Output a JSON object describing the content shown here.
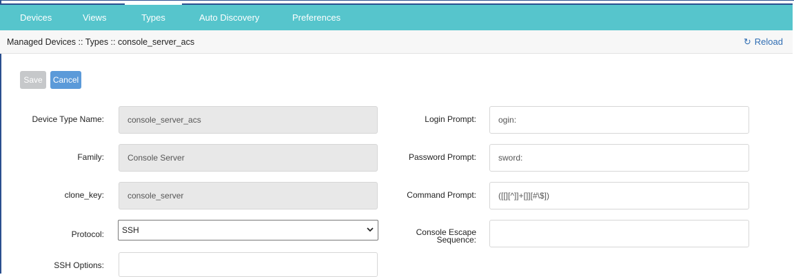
{
  "nav": {
    "tabs": [
      {
        "label": "Devices"
      },
      {
        "label": "Views"
      },
      {
        "label": "Types",
        "active": true
      },
      {
        "label": "Auto Discovery"
      },
      {
        "label": "Preferences"
      }
    ]
  },
  "breadcrumb": "Managed Devices :: Types :: console_server_acs",
  "reload_label": "Reload",
  "buttons": {
    "save": "Save",
    "cancel": "Cancel"
  },
  "form": {
    "device_type_name": {
      "label": "Device Type Name:",
      "value": "console_server_acs"
    },
    "family": {
      "label": "Family:",
      "value": "Console Server"
    },
    "clone_key": {
      "label": "clone_key:",
      "value": "console_server"
    },
    "protocol": {
      "label": "Protocol:",
      "value": "SSH"
    },
    "ssh_options": {
      "label": "SSH Options:",
      "value": ""
    },
    "login_prompt": {
      "label": "Login Prompt:",
      "value": "ogin:"
    },
    "password_prompt": {
      "label": "Password Prompt:",
      "value": "sword:"
    },
    "command_prompt": {
      "label": "Command Prompt:",
      "value": "([[][^]]+[]][#\\$])"
    },
    "console_escape_line1": "Console Escape",
    "console_escape_line2": "Sequence:",
    "console_escape_value": ""
  },
  "colors": {
    "nav_bg": "#56c5cc",
    "accent": "#2f6db3",
    "cancel": "#5b9ad9",
    "save_disabled": "#c6c8ca"
  }
}
